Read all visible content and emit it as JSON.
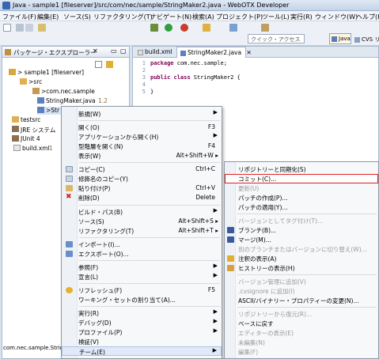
{
  "window": {
    "title": "Java - sample1 [fileserver]/src/com/nec/sample/StringMaker2.java - WebOTX Developer"
  },
  "menubar": [
    "ファイル(F)",
    "編集(E)",
    "ソース(S)",
    "リファクタリング(T)",
    "ナビゲート(N)",
    "検索(A)",
    "プロジェクト(P)",
    "ツール(L)",
    "実行(R)",
    "ウィンドウ(W)",
    "ヘルプ(H)"
  ],
  "toolbar": {
    "quick_access_placeholder": "クイック・アクセス",
    "perspective_java": "Java",
    "perspective_cvs": "CVS リ"
  },
  "explorer": {
    "tab_label": "パッケージ・エクスプローラー",
    "tree": [
      {
        "label": "> sample1  [fileserver]"
      },
      {
        "label": ">src"
      },
      {
        "label": ">com.nec.sample"
      },
      {
        "label": "StringMaker.java",
        "version": "1.2"
      },
      {
        "label": ">Str"
      },
      {
        "label": "testsrc"
      },
      {
        "label": "JRE システム"
      },
      {
        "label": "JUnit 4"
      },
      {
        "label": "build.xml",
        "version": "1"
      }
    ],
    "status_text": "com.nec.sample.String"
  },
  "editor": {
    "tabs": [
      "build.xml",
      "StringMaker2.java"
    ],
    "code": [
      {
        "no": "1",
        "kw": "package",
        "rest": " com.nec.sample;"
      },
      {
        "no": "2",
        "kw": "",
        "rest": ""
      },
      {
        "no": "3",
        "kw": "public class",
        "rest": " StringMaker2 {"
      },
      {
        "no": "4",
        "kw": "",
        "rest": ""
      },
      {
        "no": "5",
        "kw": "",
        "rest": "}"
      }
    ]
  },
  "context_menu": {
    "items": [
      {
        "label": "新規(W)",
        "submenu": true
      },
      {
        "label": "開く(O)",
        "accel": "F3"
      },
      {
        "label": "アプリケーションから開く(H)",
        "submenu": true
      },
      {
        "label": "型階層を開く(N)",
        "accel": "F4"
      },
      {
        "label": "表示(W)",
        "accel": "Alt+Shift+W ▸"
      },
      {
        "label": "コピー(C)",
        "accel": "Ctrl+C"
      },
      {
        "label": "修飾名のコピー(Y)"
      },
      {
        "label": "貼り付け(P)",
        "accel": "Ctrl+V"
      },
      {
        "label": "削除(D)",
        "accel": "Delete"
      },
      {
        "label": "ビルド・パス(B)",
        "submenu": true
      },
      {
        "label": "ソース(S)",
        "accel": "Alt+Shift+S ▸"
      },
      {
        "label": "リファクタリング(T)",
        "accel": "Alt+Shift+T ▸"
      },
      {
        "label": "インポート(I)..."
      },
      {
        "label": "エクスポート(O)..."
      },
      {
        "label": "参照(F)",
        "submenu": true
      },
      {
        "label": "宣言(L)",
        "submenu": true
      },
      {
        "label": "リフレッシュ(F)",
        "accel": "F5"
      },
      {
        "label": "ワーキング・セットの割り当て(A)..."
      },
      {
        "label": "実行(R)",
        "submenu": true
      },
      {
        "label": "デバッグ(D)",
        "submenu": true
      },
      {
        "label": "プロファイル(P)",
        "submenu": true
      },
      {
        "label": "検証(V)"
      },
      {
        "label": "チーム(E)",
        "submenu": true
      }
    ]
  },
  "team_submenu": {
    "items": [
      {
        "label": "リポジトリーと同期化(S)"
      },
      {
        "label": "コミット(C)..."
      },
      {
        "label": "更新(U)"
      },
      {
        "label": "パッチの作成(P)..."
      },
      {
        "label": "パッチの適用(Y)..."
      },
      {
        "label": "バージョンとしてタグ付け(T)..."
      },
      {
        "label": "ブランチ(B)..."
      },
      {
        "label": "マージ(M)..."
      },
      {
        "label": "別のブランチまたはバージョンに切り替え(W)..."
      },
      {
        "label": "注釈の表示(A)"
      },
      {
        "label": "ヒストリーの表示(H)"
      },
      {
        "label": "バージョン管理に追加(V)"
      },
      {
        "label": ".cvsignore に追加(I)"
      },
      {
        "label": "ASCII/バイナリー・プロパティーの変更(N)..."
      },
      {
        "label": "リポジトリーから復元(R)..."
      },
      {
        "label": "ベースに戻す"
      },
      {
        "label": "エディターの表示(E)"
      },
      {
        "label": "未編集(N)"
      },
      {
        "label": "編集(F)"
      }
    ]
  },
  "colors": {
    "accent": "#3a66b0",
    "highlight_border": "#e02020"
  }
}
